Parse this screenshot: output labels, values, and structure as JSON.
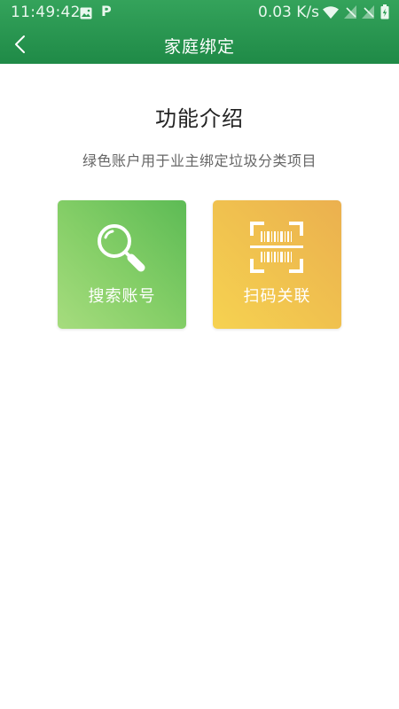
{
  "status_bar": {
    "time": "11:49:42",
    "network_speed": "0.03 K/s",
    "icons": [
      "image-icon",
      "parking-icon",
      "wifi-icon",
      "signal-icon",
      "signal-icon",
      "battery-icon"
    ],
    "p_glyph": "P"
  },
  "nav": {
    "title": "家庭绑定",
    "back_icon": "chevron-left-icon"
  },
  "intro": {
    "title": "功能介绍",
    "description": "绿色账户用于业主绑定垃圾分类项目"
  },
  "cards": [
    {
      "label": "搜索账号",
      "icon": "magnifier-icon",
      "colors": [
        "#a6dc7e",
        "#5dbb55"
      ]
    },
    {
      "label": "扫码关联",
      "icon": "barcode-scan-icon",
      "colors": [
        "#f6d250",
        "#ebb04f"
      ]
    }
  ],
  "theme": {
    "header_green": "#2a9a52",
    "text_dark": "#222222",
    "text_grey": "#666666"
  }
}
